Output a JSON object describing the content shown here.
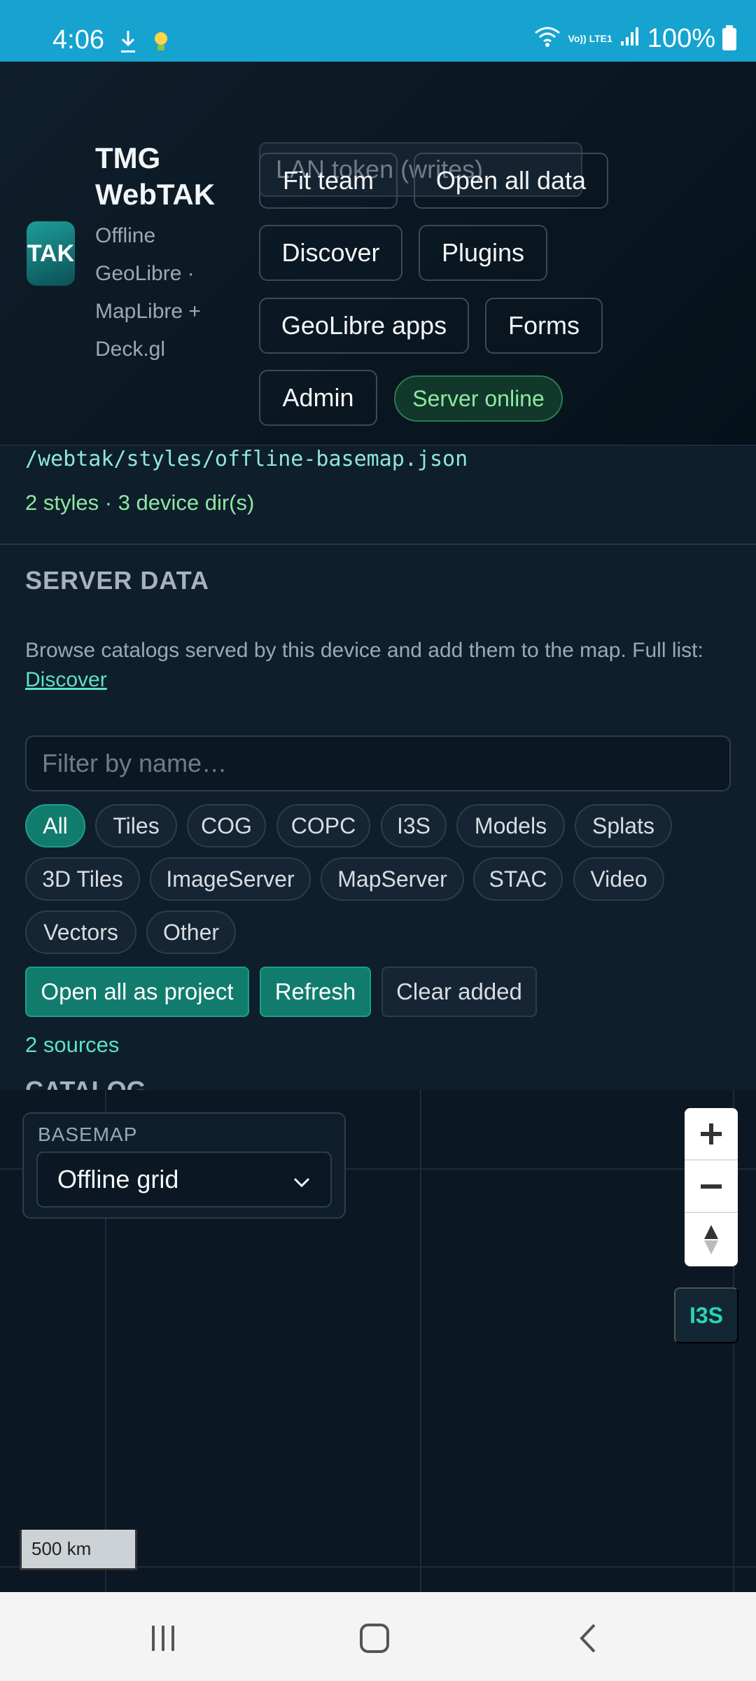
{
  "status_bar": {
    "time": "4:06",
    "battery": "100%",
    "network": "Vo)) LTE1"
  },
  "header": {
    "logo_text": "TAK",
    "title": "TMG WebTAK",
    "subtitle": "Offline GeoLibre · MapLibre + Deck.gl",
    "token_placeholder": "LAN token (writes)",
    "buttons": {
      "fit_team": "Fit team",
      "open_all_data": "Open all data",
      "discover": "Discover",
      "plugins": "Plugins",
      "geolibre_apps": "GeoLibre apps",
      "forms": "Forms",
      "admin": "Admin"
    },
    "server_status": "Server online"
  },
  "styles": {
    "path": "/webtak/styles/offline-basemap.json",
    "count_text": "2 styles · 3 device dir(s)"
  },
  "server_data": {
    "title": "SERVER DATA",
    "description": "Browse catalogs served by this device and add them to the map. Full list:",
    "discover_link": "Discover",
    "filter_placeholder": "Filter by name…",
    "chips": [
      "All",
      "Tiles",
      "COG",
      "COPC",
      "I3S",
      "Models",
      "Splats",
      "3D Tiles",
      "ImageServer",
      "MapServer",
      "STAC",
      "Video",
      "Vectors",
      "Other"
    ],
    "active_chip": "All",
    "actions": {
      "open_all_project": "Open all as project",
      "refresh": "Refresh",
      "clear_added": "Clear added"
    },
    "sources_count": "2 sources",
    "next_section": "CATALOG"
  },
  "map": {
    "basemap_label": "BASEMAP",
    "basemap_value": "Offline grid",
    "i3s_button": "I3S",
    "scale": "500 km"
  },
  "colors": {
    "status_bar": "#16a3cf",
    "accent": "#117c6e",
    "online": "#8ee7a4",
    "background": "#0b1824"
  }
}
